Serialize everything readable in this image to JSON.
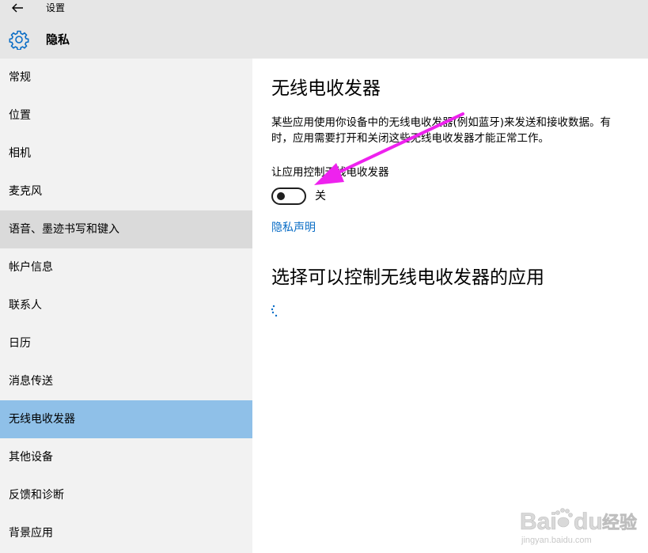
{
  "titlebar": {
    "app_title": "设置",
    "page_title": "隐私"
  },
  "sidebar": {
    "items": [
      {
        "label": "常规"
      },
      {
        "label": "位置"
      },
      {
        "label": "相机"
      },
      {
        "label": "麦克风"
      },
      {
        "label": "语音、墨迹书写和键入"
      },
      {
        "label": "帐户信息"
      },
      {
        "label": "联系人"
      },
      {
        "label": "日历"
      },
      {
        "label": "消息传送"
      },
      {
        "label": "无线电收发器"
      },
      {
        "label": "其他设备"
      },
      {
        "label": "反馈和诊断"
      },
      {
        "label": "背景应用"
      }
    ],
    "selected": "无线电收发器"
  },
  "content": {
    "section_title": "无线电收发器",
    "description": "某些应用使用你设备中的无线电收发器(例如蓝牙)来发送和接收数据。有时，应用需要打开和关闭这些无线电收发器才能正常工作。",
    "toggle_label": "让应用控制无线电收发器",
    "toggle_state": "关",
    "toggle_on": false,
    "privacy_link": "隐私声明",
    "apps_section_title": "选择可以控制无线电收发器的应用"
  },
  "watermark": {
    "brand": "Bai",
    "brand2": "du",
    "jingyan": "经验",
    "url": "jingyan.baidu.com"
  },
  "colors": {
    "titlebar_bg": "#e6e6e6",
    "sidebar_bg": "#f2f2f2",
    "hover_bg": "#dadada",
    "selected_bg": "#8fc0e8",
    "link": "#0a6dc6",
    "accent_icon": "#0a6dc6",
    "annotation_arrow": "#ee22ee"
  },
  "icons": {
    "back": "back-arrow-icon",
    "gear": "gear-icon",
    "spinner": "loading-spinner-icon"
  }
}
